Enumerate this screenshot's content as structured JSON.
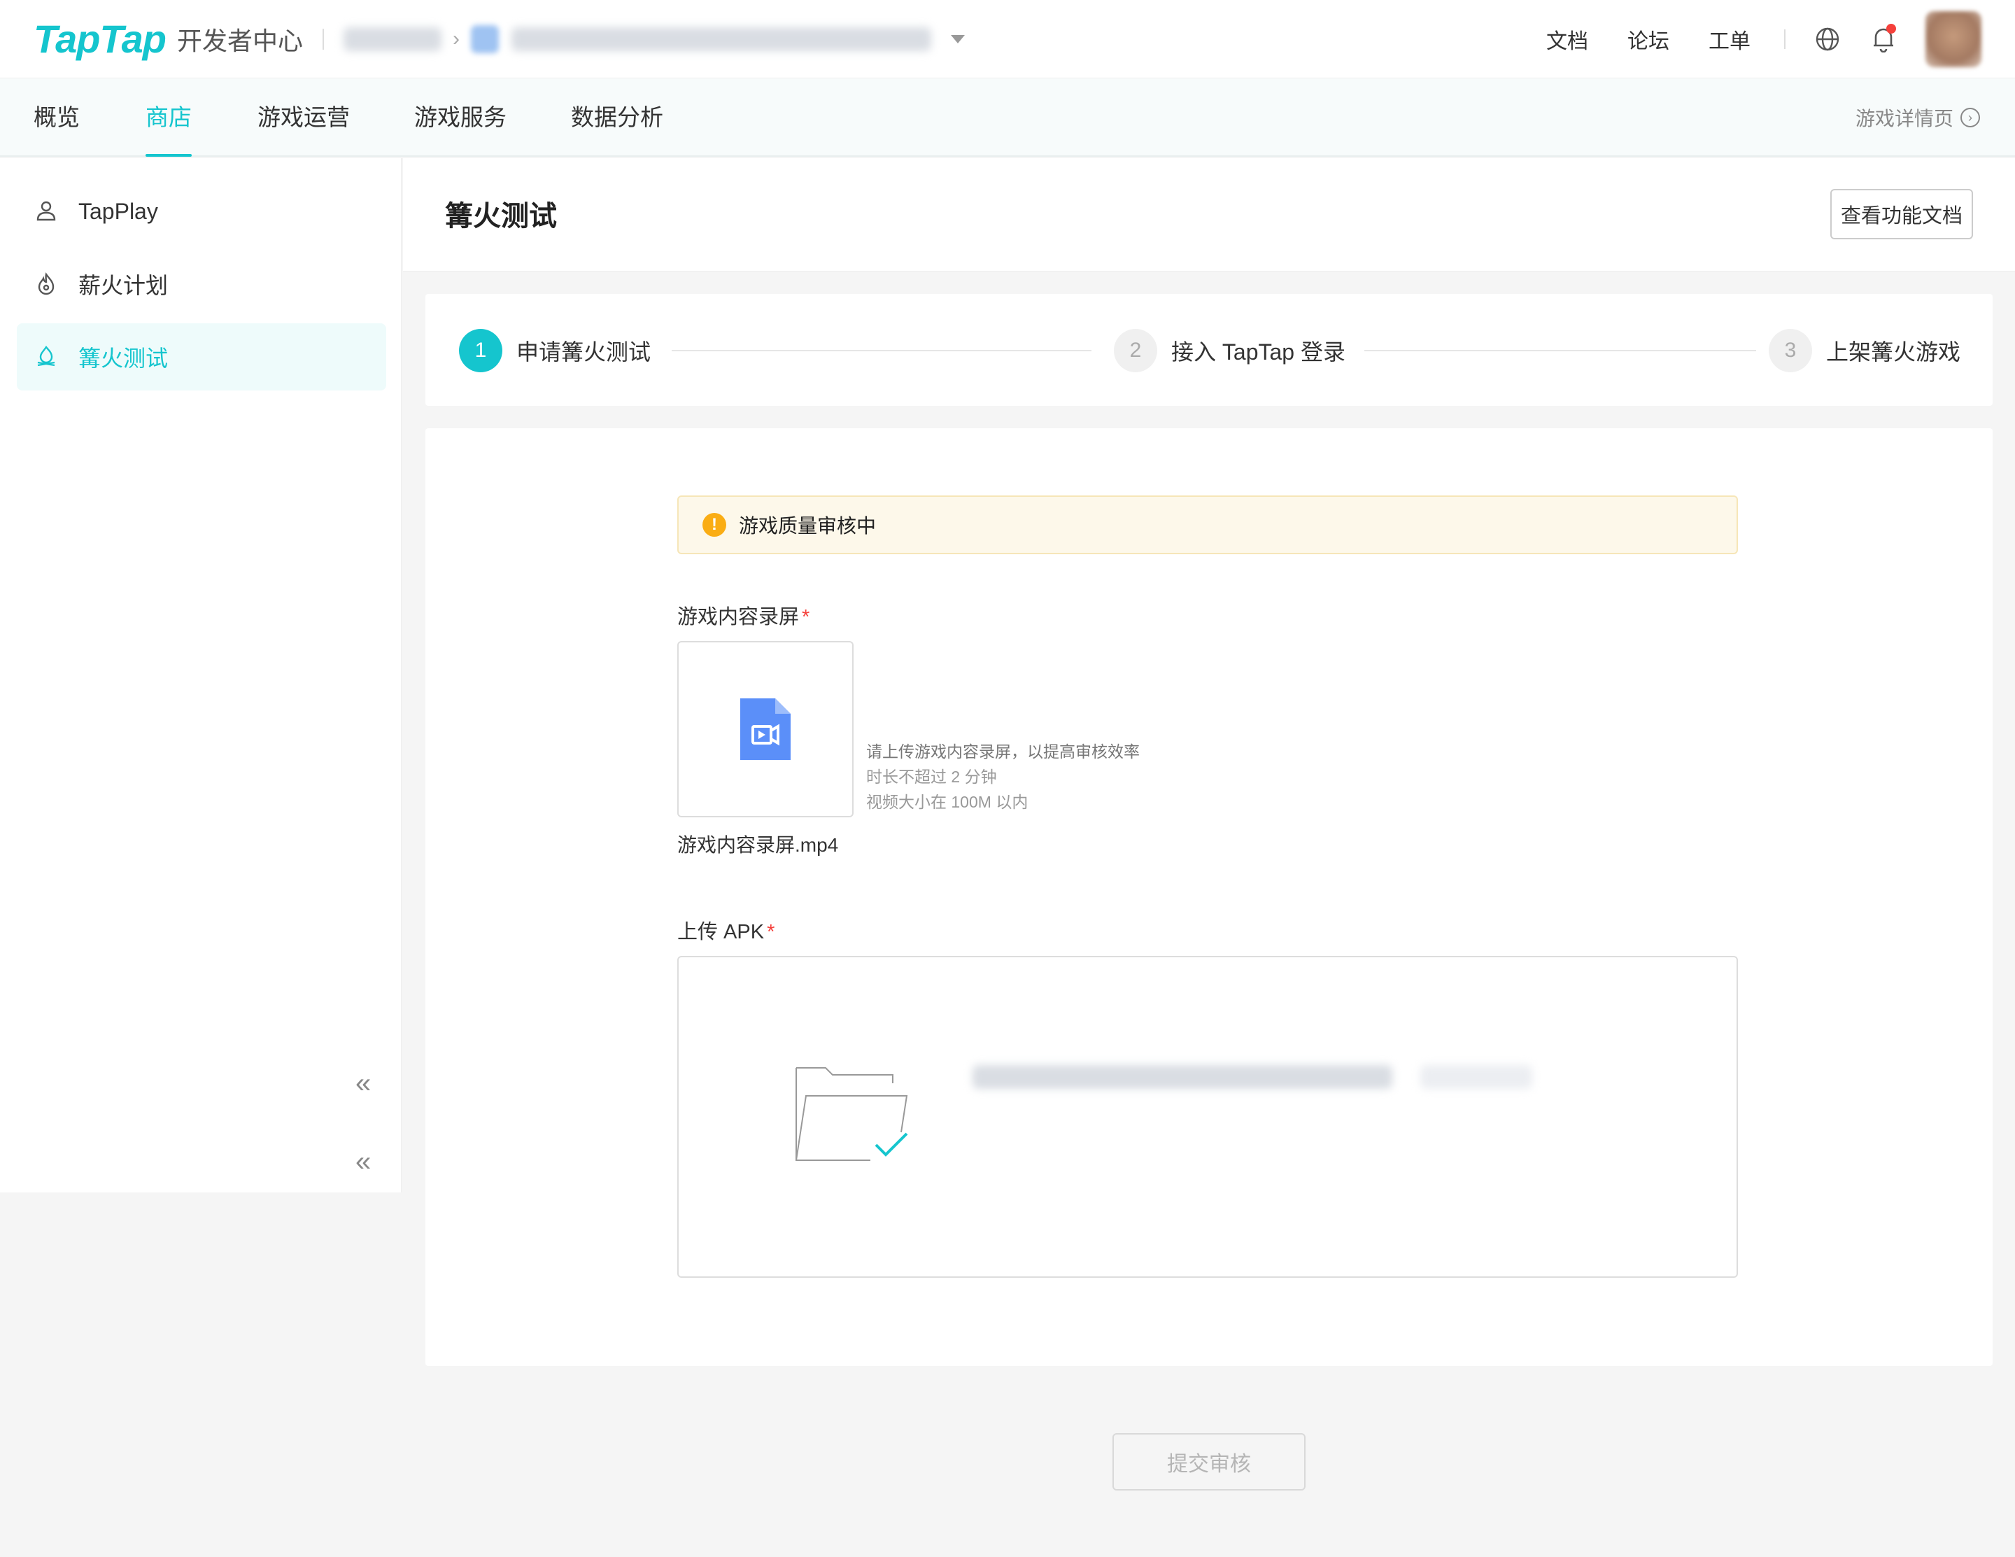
{
  "header": {
    "logo": "TapTap",
    "logo_sub": "开发者中心",
    "links": [
      "文档",
      "论坛",
      "工单"
    ]
  },
  "nav": {
    "tabs": [
      "概览",
      "商店",
      "游戏运营",
      "游戏服务",
      "数据分析"
    ],
    "active_tab": "商店",
    "detail_link": "游戏详情页"
  },
  "sidebar": {
    "items": [
      {
        "label": "TapPlay",
        "icon": "tapplay-icon"
      },
      {
        "label": "薪火计划",
        "icon": "flame-icon"
      },
      {
        "label": "篝火测试",
        "icon": "bonfire-icon"
      }
    ],
    "active_item": "篝火测试"
  },
  "page": {
    "title": "篝火测试",
    "doc_button": "查看功能文档"
  },
  "steps": [
    {
      "num": "1",
      "label": "申请篝火测试",
      "state": "active"
    },
    {
      "num": "2",
      "label": "接入 TapTap 登录",
      "state": "pending"
    },
    {
      "num": "3",
      "label": "上架篝火游戏",
      "state": "pending"
    }
  ],
  "form": {
    "alert": "游戏质量审核中",
    "video_label": "游戏内容录屏",
    "required_mark": "*",
    "video_hints": [
      "请上传游戏内容录屏，以提高审核效率",
      "时长不超过 2 分钟",
      "视频大小在 100M 以内"
    ],
    "video_file": "游戏内容录屏.mp4",
    "apk_label": "上传 APK",
    "submit": "提交审核"
  },
  "colors": {
    "accent": "#15c5ce",
    "warning": "#faad14",
    "required": "#f5403b",
    "file_icon": "#5b8ff9"
  }
}
